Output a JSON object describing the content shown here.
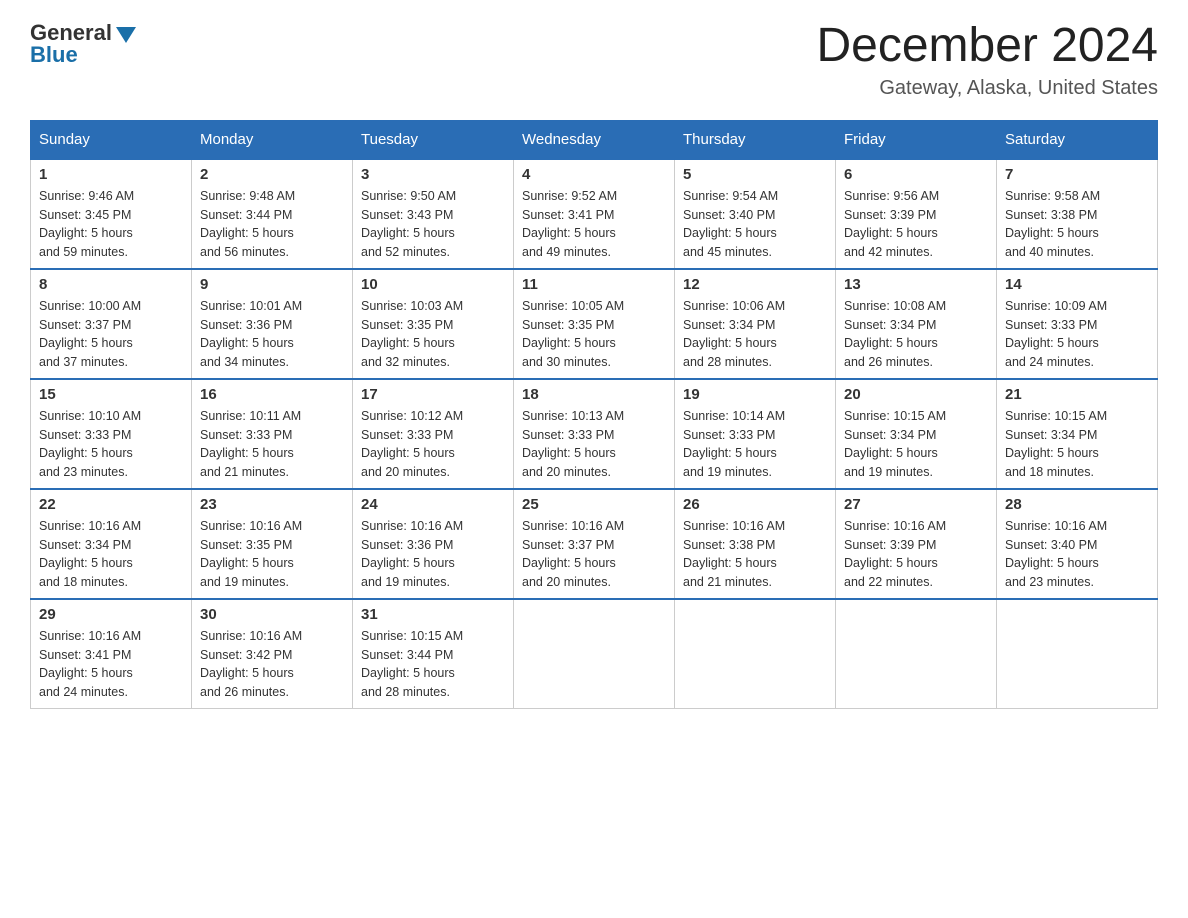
{
  "header": {
    "logo_general": "General",
    "logo_blue": "Blue",
    "title": "December 2024",
    "subtitle": "Gateway, Alaska, United States"
  },
  "days_of_week": [
    "Sunday",
    "Monday",
    "Tuesday",
    "Wednesday",
    "Thursday",
    "Friday",
    "Saturday"
  ],
  "weeks": [
    [
      {
        "day": "1",
        "sunrise": "Sunrise: 9:46 AM",
        "sunset": "Sunset: 3:45 PM",
        "daylight": "Daylight: 5 hours",
        "daylight2": "and 59 minutes."
      },
      {
        "day": "2",
        "sunrise": "Sunrise: 9:48 AM",
        "sunset": "Sunset: 3:44 PM",
        "daylight": "Daylight: 5 hours",
        "daylight2": "and 56 minutes."
      },
      {
        "day": "3",
        "sunrise": "Sunrise: 9:50 AM",
        "sunset": "Sunset: 3:43 PM",
        "daylight": "Daylight: 5 hours",
        "daylight2": "and 52 minutes."
      },
      {
        "day": "4",
        "sunrise": "Sunrise: 9:52 AM",
        "sunset": "Sunset: 3:41 PM",
        "daylight": "Daylight: 5 hours",
        "daylight2": "and 49 minutes."
      },
      {
        "day": "5",
        "sunrise": "Sunrise: 9:54 AM",
        "sunset": "Sunset: 3:40 PM",
        "daylight": "Daylight: 5 hours",
        "daylight2": "and 45 minutes."
      },
      {
        "day": "6",
        "sunrise": "Sunrise: 9:56 AM",
        "sunset": "Sunset: 3:39 PM",
        "daylight": "Daylight: 5 hours",
        "daylight2": "and 42 minutes."
      },
      {
        "day": "7",
        "sunrise": "Sunrise: 9:58 AM",
        "sunset": "Sunset: 3:38 PM",
        "daylight": "Daylight: 5 hours",
        "daylight2": "and 40 minutes."
      }
    ],
    [
      {
        "day": "8",
        "sunrise": "Sunrise: 10:00 AM",
        "sunset": "Sunset: 3:37 PM",
        "daylight": "Daylight: 5 hours",
        "daylight2": "and 37 minutes."
      },
      {
        "day": "9",
        "sunrise": "Sunrise: 10:01 AM",
        "sunset": "Sunset: 3:36 PM",
        "daylight": "Daylight: 5 hours",
        "daylight2": "and 34 minutes."
      },
      {
        "day": "10",
        "sunrise": "Sunrise: 10:03 AM",
        "sunset": "Sunset: 3:35 PM",
        "daylight": "Daylight: 5 hours",
        "daylight2": "and 32 minutes."
      },
      {
        "day": "11",
        "sunrise": "Sunrise: 10:05 AM",
        "sunset": "Sunset: 3:35 PM",
        "daylight": "Daylight: 5 hours",
        "daylight2": "and 30 minutes."
      },
      {
        "day": "12",
        "sunrise": "Sunrise: 10:06 AM",
        "sunset": "Sunset: 3:34 PM",
        "daylight": "Daylight: 5 hours",
        "daylight2": "and 28 minutes."
      },
      {
        "day": "13",
        "sunrise": "Sunrise: 10:08 AM",
        "sunset": "Sunset: 3:34 PM",
        "daylight": "Daylight: 5 hours",
        "daylight2": "and 26 minutes."
      },
      {
        "day": "14",
        "sunrise": "Sunrise: 10:09 AM",
        "sunset": "Sunset: 3:33 PM",
        "daylight": "Daylight: 5 hours",
        "daylight2": "and 24 minutes."
      }
    ],
    [
      {
        "day": "15",
        "sunrise": "Sunrise: 10:10 AM",
        "sunset": "Sunset: 3:33 PM",
        "daylight": "Daylight: 5 hours",
        "daylight2": "and 23 minutes."
      },
      {
        "day": "16",
        "sunrise": "Sunrise: 10:11 AM",
        "sunset": "Sunset: 3:33 PM",
        "daylight": "Daylight: 5 hours",
        "daylight2": "and 21 minutes."
      },
      {
        "day": "17",
        "sunrise": "Sunrise: 10:12 AM",
        "sunset": "Sunset: 3:33 PM",
        "daylight": "Daylight: 5 hours",
        "daylight2": "and 20 minutes."
      },
      {
        "day": "18",
        "sunrise": "Sunrise: 10:13 AM",
        "sunset": "Sunset: 3:33 PM",
        "daylight": "Daylight: 5 hours",
        "daylight2": "and 20 minutes."
      },
      {
        "day": "19",
        "sunrise": "Sunrise: 10:14 AM",
        "sunset": "Sunset: 3:33 PM",
        "daylight": "Daylight: 5 hours",
        "daylight2": "and 19 minutes."
      },
      {
        "day": "20",
        "sunrise": "Sunrise: 10:15 AM",
        "sunset": "Sunset: 3:34 PM",
        "daylight": "Daylight: 5 hours",
        "daylight2": "and 19 minutes."
      },
      {
        "day": "21",
        "sunrise": "Sunrise: 10:15 AM",
        "sunset": "Sunset: 3:34 PM",
        "daylight": "Daylight: 5 hours",
        "daylight2": "and 18 minutes."
      }
    ],
    [
      {
        "day": "22",
        "sunrise": "Sunrise: 10:16 AM",
        "sunset": "Sunset: 3:34 PM",
        "daylight": "Daylight: 5 hours",
        "daylight2": "and 18 minutes."
      },
      {
        "day": "23",
        "sunrise": "Sunrise: 10:16 AM",
        "sunset": "Sunset: 3:35 PM",
        "daylight": "Daylight: 5 hours",
        "daylight2": "and 19 minutes."
      },
      {
        "day": "24",
        "sunrise": "Sunrise: 10:16 AM",
        "sunset": "Sunset: 3:36 PM",
        "daylight": "Daylight: 5 hours",
        "daylight2": "and 19 minutes."
      },
      {
        "day": "25",
        "sunrise": "Sunrise: 10:16 AM",
        "sunset": "Sunset: 3:37 PM",
        "daylight": "Daylight: 5 hours",
        "daylight2": "and 20 minutes."
      },
      {
        "day": "26",
        "sunrise": "Sunrise: 10:16 AM",
        "sunset": "Sunset: 3:38 PM",
        "daylight": "Daylight: 5 hours",
        "daylight2": "and 21 minutes."
      },
      {
        "day": "27",
        "sunrise": "Sunrise: 10:16 AM",
        "sunset": "Sunset: 3:39 PM",
        "daylight": "Daylight: 5 hours",
        "daylight2": "and 22 minutes."
      },
      {
        "day": "28",
        "sunrise": "Sunrise: 10:16 AM",
        "sunset": "Sunset: 3:40 PM",
        "daylight": "Daylight: 5 hours",
        "daylight2": "and 23 minutes."
      }
    ],
    [
      {
        "day": "29",
        "sunrise": "Sunrise: 10:16 AM",
        "sunset": "Sunset: 3:41 PM",
        "daylight": "Daylight: 5 hours",
        "daylight2": "and 24 minutes."
      },
      {
        "day": "30",
        "sunrise": "Sunrise: 10:16 AM",
        "sunset": "Sunset: 3:42 PM",
        "daylight": "Daylight: 5 hours",
        "daylight2": "and 26 minutes."
      },
      {
        "day": "31",
        "sunrise": "Sunrise: 10:15 AM",
        "sunset": "Sunset: 3:44 PM",
        "daylight": "Daylight: 5 hours",
        "daylight2": "and 28 minutes."
      },
      null,
      null,
      null,
      null
    ]
  ]
}
